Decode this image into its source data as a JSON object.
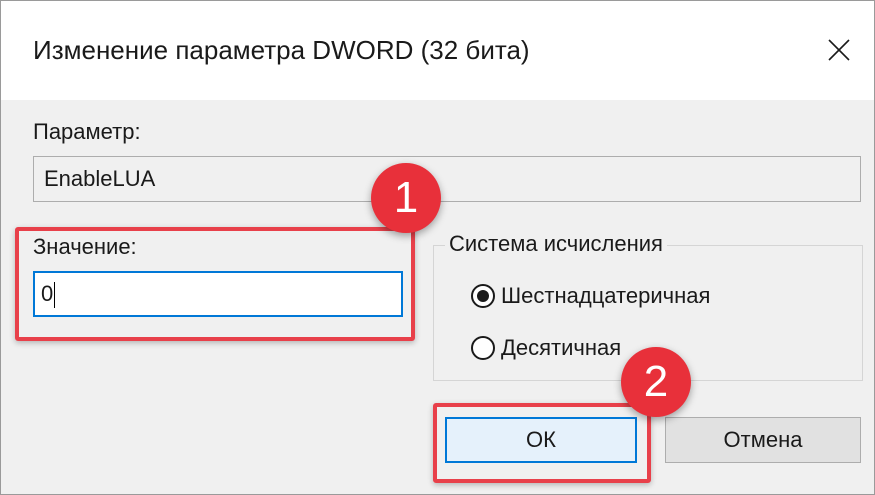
{
  "window": {
    "title": "Изменение параметра DWORD (32 бита)",
    "close_icon": "close-icon"
  },
  "parameter": {
    "label": "Параметр:",
    "value": "EnableLUA"
  },
  "value_field": {
    "label": "Значение:",
    "value": "0"
  },
  "number_system": {
    "legend": "Система исчисления",
    "options": [
      {
        "label": "Шестнадцатеричная",
        "selected": true
      },
      {
        "label": "Десятичная",
        "selected": false
      }
    ]
  },
  "buttons": {
    "ok_label": "ОК",
    "cancel_label": "Отмена"
  },
  "annotations": {
    "step1": "1",
    "step2": "2",
    "highlight_color": "#e8404a",
    "badge_color": "#e8303a"
  },
  "colors": {
    "accent": "#0078d7",
    "dialog_bg": "#f0f0f0"
  }
}
